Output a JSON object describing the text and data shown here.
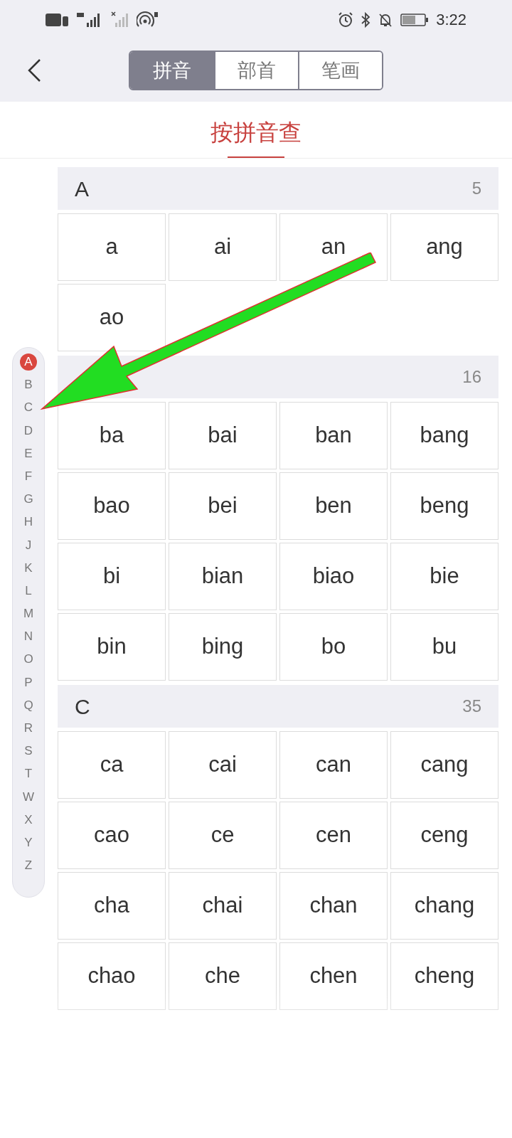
{
  "status_bar": {
    "time": "3:22"
  },
  "tabs": [
    {
      "label": "拼音",
      "selected": true
    },
    {
      "label": "部首",
      "selected": false
    },
    {
      "label": "笔画",
      "selected": false
    }
  ],
  "title": "按拼音查",
  "sections": [
    {
      "letter": "A",
      "count": "5",
      "syllables": [
        "a",
        "ai",
        "an",
        "ang",
        "ao"
      ]
    },
    {
      "count": "16",
      "syllables": [
        "ba",
        "bai",
        "ban",
        "bang",
        "bao",
        "bei",
        "ben",
        "beng",
        "bi",
        "bian",
        "biao",
        "bie",
        "bin",
        "bing",
        "bo",
        "bu"
      ]
    },
    {
      "letter": "C",
      "count": "35",
      "syllables": [
        "ca",
        "cai",
        "can",
        "cang",
        "cao",
        "ce",
        "cen",
        "ceng",
        "cha",
        "chai",
        "chan",
        "chang",
        "chao",
        "che",
        "chen",
        "cheng"
      ]
    }
  ],
  "index": [
    {
      "letter": "A",
      "selected": true
    },
    {
      "letter": "B",
      "selected": false
    },
    {
      "letter": "C",
      "selected": false
    },
    {
      "letter": "D",
      "selected": false
    },
    {
      "letter": "E",
      "selected": false
    },
    {
      "letter": "F",
      "selected": false
    },
    {
      "letter": "G",
      "selected": false
    },
    {
      "letter": "H",
      "selected": false
    },
    {
      "letter": "J",
      "selected": false
    },
    {
      "letter": "K",
      "selected": false
    },
    {
      "letter": "L",
      "selected": false
    },
    {
      "letter": "M",
      "selected": false
    },
    {
      "letter": "N",
      "selected": false
    },
    {
      "letter": "O",
      "selected": false
    },
    {
      "letter": "P",
      "selected": false
    },
    {
      "letter": "Q",
      "selected": false
    },
    {
      "letter": "R",
      "selected": false
    },
    {
      "letter": "S",
      "selected": false
    },
    {
      "letter": "T",
      "selected": false
    },
    {
      "letter": "W",
      "selected": false
    },
    {
      "letter": "X",
      "selected": false
    },
    {
      "letter": "Y",
      "selected": false
    },
    {
      "letter": "Z",
      "selected": false
    }
  ]
}
